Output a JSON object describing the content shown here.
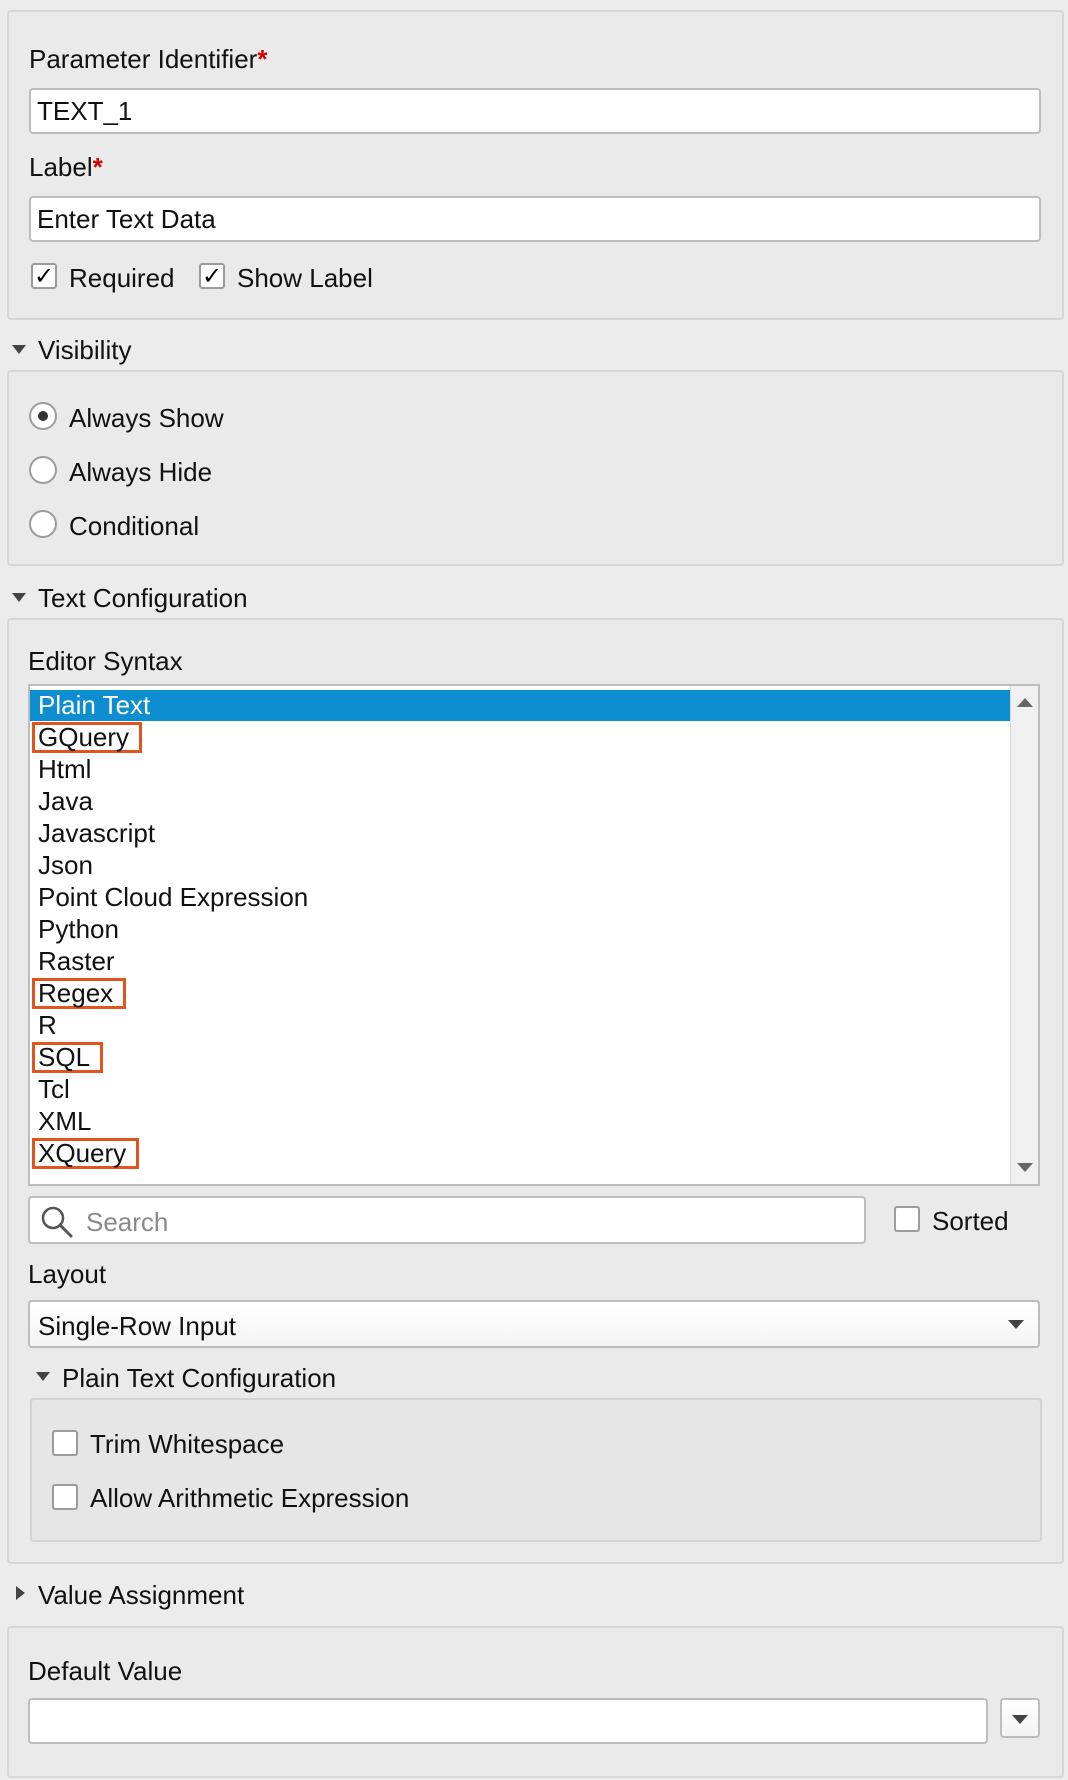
{
  "basic": {
    "param_id_label": "Parameter Identifier",
    "param_id_value": "TEXT_1",
    "label_label": "Label",
    "label_value": "Enter Text Data",
    "required_asterisk": "*",
    "required_label": "Required",
    "required_checked": true,
    "show_label_label": "Show Label",
    "show_label_checked": true,
    "check_mark": "✓"
  },
  "visibility": {
    "title": "Visibility",
    "options": [
      {
        "label": "Always Show",
        "selected": true
      },
      {
        "label": "Always Hide",
        "selected": false
      },
      {
        "label": "Conditional",
        "selected": false
      }
    ]
  },
  "text_config": {
    "title": "Text Configuration",
    "editor_syntax_label": "Editor Syntax",
    "syntax_options": [
      {
        "label": "Plain Text",
        "selected": true,
        "highlighted": false
      },
      {
        "label": "GQuery",
        "selected": false,
        "highlighted": true
      },
      {
        "label": "Html",
        "selected": false,
        "highlighted": false
      },
      {
        "label": "Java",
        "selected": false,
        "highlighted": false
      },
      {
        "label": "Javascript",
        "selected": false,
        "highlighted": false
      },
      {
        "label": "Json",
        "selected": false,
        "highlighted": false
      },
      {
        "label": "Point Cloud Expression",
        "selected": false,
        "highlighted": false
      },
      {
        "label": "Python",
        "selected": false,
        "highlighted": false
      },
      {
        "label": "Raster",
        "selected": false,
        "highlighted": false
      },
      {
        "label": "Regex",
        "selected": false,
        "highlighted": true
      },
      {
        "label": "R",
        "selected": false,
        "highlighted": false
      },
      {
        "label": "SQL",
        "selected": false,
        "highlighted": true
      },
      {
        "label": "Tcl",
        "selected": false,
        "highlighted": false
      },
      {
        "label": "XML",
        "selected": false,
        "highlighted": false
      },
      {
        "label": "XQuery",
        "selected": false,
        "highlighted": true
      }
    ],
    "search_placeholder": "Search",
    "sorted_label": "Sorted",
    "sorted_checked": false,
    "layout_label": "Layout",
    "layout_value": "Single-Row Input",
    "plain_text_config_title": "Plain Text Configuration",
    "trim_whitespace_label": "Trim Whitespace",
    "trim_whitespace_checked": false,
    "allow_arith_label": "Allow Arithmetic Expression",
    "allow_arith_checked": false
  },
  "value_assignment": {
    "title": "Value Assignment",
    "default_value_label": "Default Value",
    "default_value": ""
  },
  "colors": {
    "selection": "#0d8ed0",
    "highlight_border": "#e2541b",
    "required": "#d40000"
  }
}
